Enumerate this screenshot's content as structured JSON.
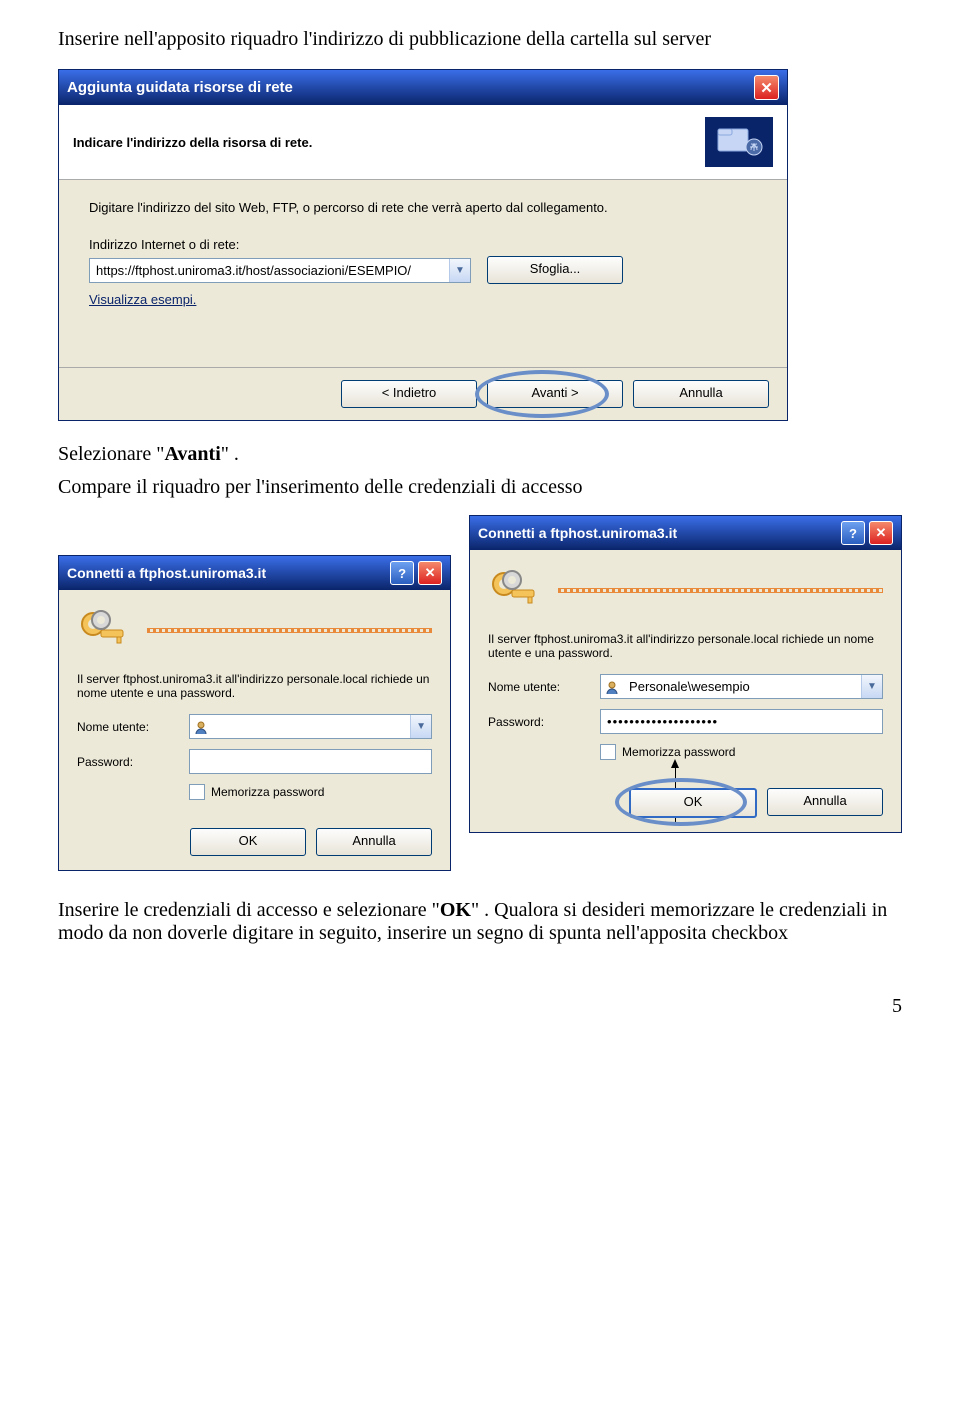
{
  "doc": {
    "intro": "Inserire nell'apposito riquadro l'indirizzo di pubblicazione della cartella sul server",
    "select_avanti_pre": "Selezionare \"",
    "select_avanti_bold": "Avanti",
    "select_avanti_post": "\" .",
    "compare_line": "Compare il riquadro per l'inserimento delle credenziali di accesso",
    "insert_pre": "Inserire le credenziali di accesso e selezionare \"",
    "insert_bold": "OK",
    "insert_post": "\" . Qualora si desideri memorizzare le credenziali in modo da non doverle digitare in seguito, inserire un segno di spunta nell'apposita checkbox",
    "page_number": "5"
  },
  "wizard": {
    "title": "Aggiunta guidata risorse di rete",
    "header": "Indicare l'indirizzo della risorsa di rete.",
    "instruction": "Digitare l'indirizzo del sito Web, FTP, o percorso di rete che verrà aperto dal collegamento.",
    "address_label": "Indirizzo Internet o di rete:",
    "address_value": "https://ftphost.uniroma3.it/host/associazioni/ESEMPIO/",
    "browse": "Sfoglia...",
    "examples_link": "Visualizza esempi.",
    "back": "< Indietro",
    "next": "Avanti >",
    "cancel": "Annulla"
  },
  "cred": {
    "title": "Connetti a ftphost.uniroma3.it",
    "server_text": "Il server ftphost.uniroma3.it all'indirizzo personale.local richiede un nome utente e una password.",
    "user_label": "Nome utente:",
    "pass_label": "Password:",
    "remember": "Memorizza password",
    "ok": "OK",
    "cancel": "Annulla",
    "filled_user": "Personale\\wesempio",
    "filled_pass": "••••••••••••••••••••"
  }
}
